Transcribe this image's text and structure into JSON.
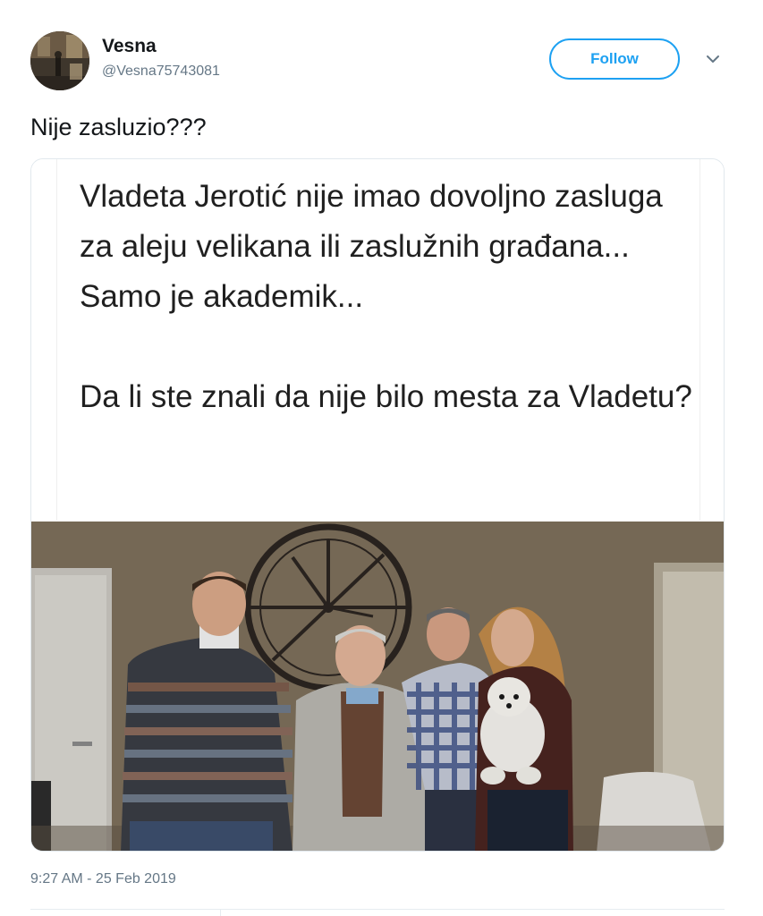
{
  "tweet": {
    "author": {
      "display_name": "Vesna",
      "handle": "@Vesna75743081",
      "avatar_icon": "user-avatar"
    },
    "follow_label": "Follow",
    "menu_icon": "chevron-down-icon",
    "text": "Nije zasluzio???",
    "media": {
      "text_card": {
        "paragraph_1": "Vladeta Jerotić nije imao dovoljno zasluga za aleju velikana ili zaslužnih građana... Samo je akademik...",
        "paragraph_2": "Da li ste znali da nije bilo mesta za Vladetu?"
      }
    },
    "timestamp": "9:27 AM - 25 Feb 2019"
  },
  "colors": {
    "accent": "#1da1f2",
    "secondary_text": "#657786",
    "primary_text": "#14171a"
  }
}
